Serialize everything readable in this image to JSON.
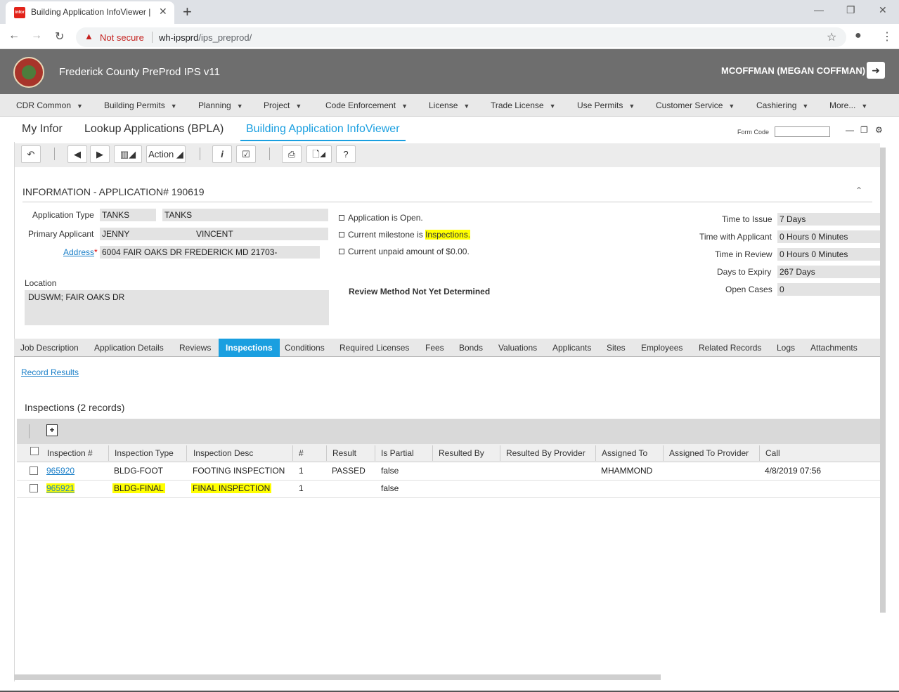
{
  "browser": {
    "tab_title": "Building Application InfoViewer |",
    "tab_favicon": "infor",
    "not_secure": "Not secure",
    "url_host": "wh-ipsprd",
    "url_path": "/ips_preprod/"
  },
  "header": {
    "app_name": "Frederick County PreProd IPS v11",
    "user": "MCOFFMAN (MEGAN COFFMAN)"
  },
  "menu": [
    "CDR Common",
    "Building Permits",
    "Planning",
    "Project",
    "Code Enforcement",
    "License",
    "Trade License",
    "Use Permits",
    "Customer Service",
    "Cashiering",
    "More..."
  ],
  "page_tabs": [
    "My Infor",
    "Lookup Applications (BPLA)",
    "Building Application InfoViewer"
  ],
  "form_code_label": "Form Code",
  "actions": {
    "action_label": "Action"
  },
  "info": {
    "title": "INFORMATION - APPLICATION# 190619",
    "app_type_label": "Application Type",
    "app_type_1": "TANKS",
    "app_type_2": "TANKS",
    "primary_applicant_label": "Primary Applicant",
    "applicant_first": "JENNY",
    "applicant_last": "VINCENT",
    "address_label": "Address",
    "address_req": "*",
    "address_value": "6004 FAIR OAKS DR FREDERICK MD 21703-",
    "location_label": "Location",
    "location_value": "DUSWM; FAIR OAKS DR",
    "status_open": "Application is Open.",
    "milestone_prefix": "Current milestone is",
    "milestone_value": "Inspections.",
    "unpaid": "Current unpaid amount of $0.00.",
    "review_method": "Review Method Not Yet Determined",
    "time_to_issue_label": "Time to Issue",
    "time_to_issue": "7 Days",
    "time_with_applicant_label": "Time with Applicant",
    "time_with_applicant": "0 Hours 0 Minutes",
    "time_in_review_label": "Time in Review",
    "time_in_review": "0 Hours 0 Minutes",
    "days_to_expiry_label": "Days to Expiry",
    "days_to_expiry": "267 Days",
    "open_cases_label": "Open Cases",
    "open_cases": "0"
  },
  "sub_tabs": [
    "Job Description",
    "Application Details",
    "Reviews",
    "Inspections",
    "Conditions",
    "Required Licenses",
    "Fees",
    "Bonds",
    "Valuations",
    "Applicants",
    "Sites",
    "Employees",
    "Related Records",
    "Logs",
    "Attachments"
  ],
  "record_results": "Record Results",
  "inspections": {
    "header": "Inspections (2 records)",
    "columns": [
      "Inspection #",
      "Inspection Type",
      "Inspection Desc",
      "#",
      "Result",
      "Is Partial",
      "Resulted By",
      "Resulted By Provider",
      "Assigned To",
      "Assigned To Provider",
      "Call"
    ],
    "rows": [
      {
        "number": "965920",
        "type": "BLDG-FOOT",
        "desc": "FOOTING INSPECTION",
        "count": "1",
        "result": "PASSED",
        "partial": "false",
        "resulted_by": "",
        "resulted_by_provider": "",
        "assigned_to": "MHAMMOND",
        "assigned_to_provider": "",
        "call": "4/8/2019 07:56"
      },
      {
        "number": "965921",
        "type": "BLDG-FINAL",
        "desc": "FINAL INSPECTION",
        "count": "1",
        "result": "",
        "partial": "false",
        "resulted_by": "",
        "resulted_by_provider": "",
        "assigned_to": "",
        "assigned_to_provider": "",
        "call": ""
      }
    ]
  },
  "colors": {
    "accent": "#1a9fe0",
    "header_bg": "#6e6e6e",
    "highlight": "#ffff00"
  }
}
